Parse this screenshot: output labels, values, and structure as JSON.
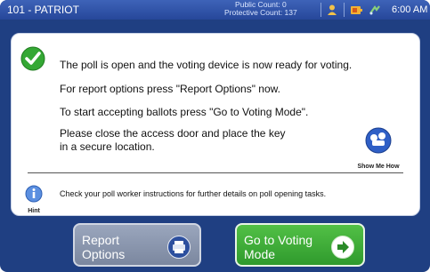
{
  "topbar": {
    "title": "101 - PATRIOT",
    "public_count": "Public Count: 0",
    "protective_count": "Protective Count: 137",
    "time": "6:00 AM"
  },
  "main": {
    "message_1": "The poll is open and the voting device is now ready for voting.",
    "message_2": "For report options press \"Report Options\" now.",
    "message_3": "To start accepting ballots press \"Go to Voting Mode\".",
    "message_4_line1": "Please close the access door and place the key",
    "message_4_line2": "in a secure location.",
    "show_me_how_label": "Show Me How",
    "hint_label": "Hint",
    "hint_text": "Check your poll worker instructions for further details on poll opening tasks."
  },
  "buttons": {
    "report_line1": "Report",
    "report_line2": "Options",
    "vote_line1": "Go to Voting",
    "vote_line2": "Mode"
  },
  "colors": {
    "background": "#1f3f82",
    "topbar": "#2f52a8",
    "report_button": "#8a95ad",
    "vote_button": "#3fad39",
    "check_green": "#34a834"
  },
  "icons": [
    "checkmark-icon",
    "show-me-how-icon",
    "hint-info-icon",
    "printer-icon",
    "arrow-right-icon",
    "user-icon",
    "battery-icon",
    "power-icon"
  ]
}
